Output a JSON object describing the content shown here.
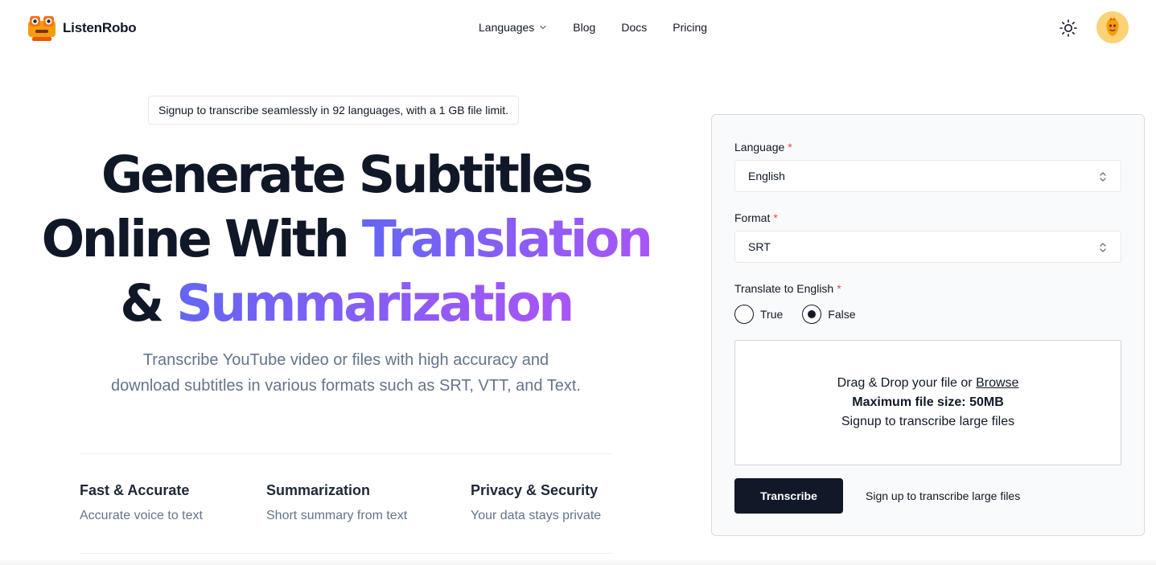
{
  "brand": {
    "name": "ListenRobo"
  },
  "nav": {
    "items": [
      {
        "label": "Languages"
      },
      {
        "label": "Blog"
      },
      {
        "label": "Docs"
      },
      {
        "label": "Pricing"
      }
    ]
  },
  "hero": {
    "badge": "Signup to transcribe seamlessly in 92 languages, with a 1 GB file limit.",
    "title_line1": "Generate Subtitles",
    "title_line2_a": "Online With ",
    "title_line2_b": "Translation",
    "title_line3_a": "& ",
    "title_line3_b": "Summarization",
    "subtitle_line1": "Transcribe YouTube video or files with high accuracy and",
    "subtitle_line2": "download subtitles in various formats such as SRT, VTT, and Text."
  },
  "features": [
    {
      "title": "Fast & Accurate",
      "desc": "Accurate voice to text"
    },
    {
      "title": "Summarization",
      "desc": "Short summary from text"
    },
    {
      "title": "Privacy & Security",
      "desc": "Your data stays private"
    }
  ],
  "form": {
    "language_label": "Language",
    "language_value": "English",
    "format_label": "Format",
    "format_value": "SRT",
    "translate_label": "Translate to English",
    "required_mark": "*",
    "options": [
      {
        "label": "True",
        "selected": false
      },
      {
        "label": "False",
        "selected": true
      }
    ],
    "dropzone": {
      "line1_prefix": "Drag & Drop your file or ",
      "browse": "Browse",
      "max_size": "Maximum file size: 50MB",
      "signup_hint": "Signup to transcribe large files"
    },
    "submit_label": "Transcribe",
    "signup_link": "Sign up to transcribe large files"
  },
  "colors": {
    "accent_start": "#6366f1",
    "accent_end": "#a855f7",
    "primary_button": "#111827",
    "required": "#ef4444",
    "avatar_bg": "#fcd277"
  },
  "icons": {
    "logo": "robot-logo-icon",
    "nav_dropdown": "chevron-down-icon",
    "theme": "sun-icon",
    "avatar": "avatar-icon",
    "select_caret": "chevron-up-down-icon"
  }
}
